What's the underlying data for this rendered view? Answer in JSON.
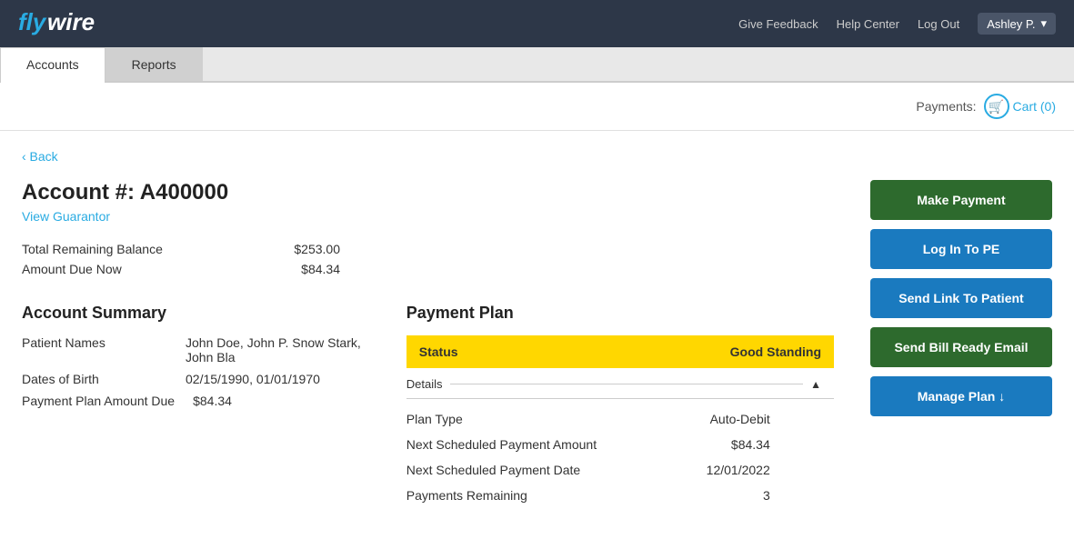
{
  "header": {
    "logo": "flywire",
    "nav": {
      "feedback": "Give Feedback",
      "help": "Help Center",
      "logout": "Log Out"
    },
    "user": "Ashley P."
  },
  "tabs": [
    {
      "id": "accounts",
      "label": "Accounts",
      "active": true
    },
    {
      "id": "reports",
      "label": "Reports",
      "active": false
    }
  ],
  "payments_bar": {
    "label": "Payments:",
    "cart": "Cart (0)"
  },
  "back_link": "‹ Back",
  "account": {
    "number_label": "Account #: A400000",
    "view_guarantor": "View Guarantor",
    "total_remaining_label": "Total Remaining Balance",
    "total_remaining_value": "$253.00",
    "amount_due_label": "Amount Due Now",
    "amount_due_value": "$84.34"
  },
  "account_summary": {
    "title": "Account Summary",
    "patient_names_label": "Patient Names",
    "patient_names_value": "John Doe, John P. Snow Stark, John Bla",
    "dates_of_birth_label": "Dates of Birth",
    "dates_of_birth_value": "02/15/1990, 01/01/1970",
    "payment_plan_due_label": "Payment Plan Amount Due",
    "payment_plan_due_value": "$84.34"
  },
  "payment_plan": {
    "title": "Payment Plan",
    "status_label": "Status",
    "status_value": "Good Standing",
    "details_label": "Details",
    "plan_type_label": "Plan Type",
    "plan_type_value": "Auto-Debit",
    "next_amount_label": "Next Scheduled Payment Amount",
    "next_amount_value": "$84.34",
    "next_date_label": "Next Scheduled Payment Date",
    "next_date_value": "12/01/2022",
    "payments_remaining_label": "Payments Remaining",
    "payments_remaining_value": "3"
  },
  "buttons": {
    "make_payment": "Make Payment",
    "log_in_to_pe": "Log In To PE",
    "send_link_to_patient": "Send Link To Patient",
    "send_bill_ready_email": "Send Bill Ready Email",
    "manage_plan": "Manage Plan ↓"
  }
}
